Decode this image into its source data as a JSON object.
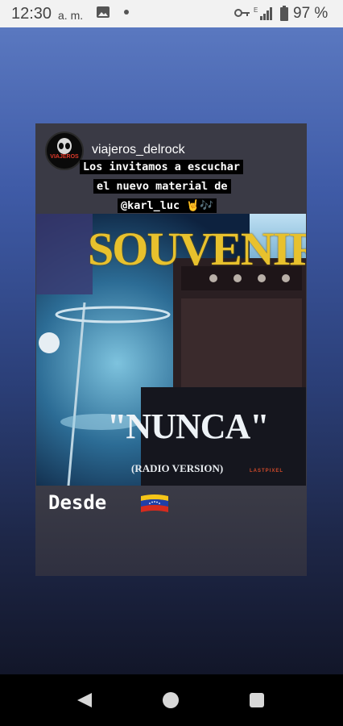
{
  "status_bar": {
    "time": "12:30",
    "ampm": "a. m.",
    "battery": "97 %"
  },
  "story": {
    "username": "viajeros_delrock",
    "avatar_text": "VIAJEROS",
    "caption_lines": [
      "Los invitamos a escuchar",
      "el nuevo material de",
      "@karl_luc 🤘🎶"
    ],
    "artwork": {
      "title": "SOUVENIR",
      "song": "\"NUNCA\"",
      "subtitle": "(RADIO VERSION)",
      "label": "LASTPIXEL"
    },
    "footer_text": "Desde",
    "flag": "venezuela-flag"
  },
  "nav": {
    "back_icon": "back-icon",
    "home_icon": "home-icon",
    "recents_icon": "recents-icon"
  }
}
